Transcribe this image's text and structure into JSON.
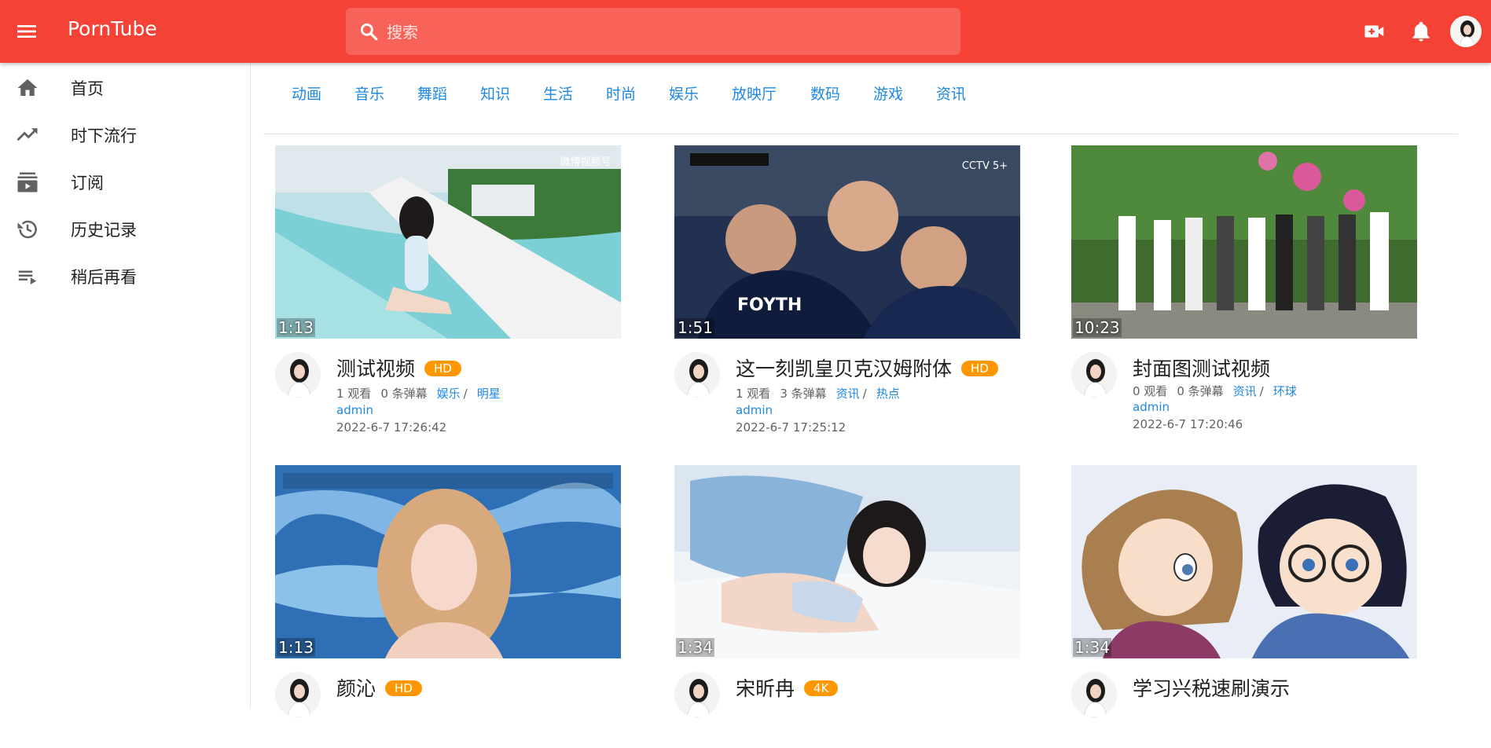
{
  "header": {
    "brand": "PornTube",
    "search_placeholder": "搜索"
  },
  "sidebar": {
    "items": [
      {
        "label": "首页",
        "icon": "home-icon"
      },
      {
        "label": "时下流行",
        "icon": "trending-icon"
      },
      {
        "label": "订阅",
        "icon": "subscriptions-icon"
      },
      {
        "label": "历史记录",
        "icon": "history-icon"
      },
      {
        "label": "稍后再看",
        "icon": "watch-later-icon"
      }
    ]
  },
  "categories": [
    "动画",
    "音乐",
    "舞蹈",
    "知识",
    "生活",
    "时尚",
    "娱乐",
    "放映厅",
    "数码",
    "游戏",
    "资讯"
  ],
  "videos": [
    {
      "title": "测试视频",
      "badge": "HD",
      "duration": "1:13",
      "views": "1 观看",
      "danmaku": "0 条弹幕",
      "tag1": "娱乐",
      "tag2": "明星",
      "author": "admin",
      "date": "2022-6-7 17:26:42"
    },
    {
      "title": "这一刻凯皇贝克汉姆附体",
      "badge": "HD",
      "duration": "1:51",
      "views": "1 观看",
      "danmaku": "3 条弹幕",
      "tag1": "资讯",
      "tag2": "热点",
      "author": "admin",
      "date": "2022-6-7 17:25:12"
    },
    {
      "title": "封面图测试视频",
      "badge": "",
      "duration": "10:23",
      "views": "0 观看",
      "danmaku": "0 条弹幕",
      "tag1": "资讯",
      "tag2": "环球",
      "author": "admin",
      "date": "2022-6-7 17:20:46"
    },
    {
      "title": "颜沁",
      "badge": "HD",
      "duration": "1:13"
    },
    {
      "title": "宋昕冉",
      "badge": "4K",
      "duration": "1:34"
    },
    {
      "title": "学习兴税速刷演示",
      "badge": "",
      "duration": "1:34"
    }
  ],
  "colors": {
    "primary": "#f44336",
    "accent_link": "#1e88e5",
    "badge": "#ff9800"
  }
}
